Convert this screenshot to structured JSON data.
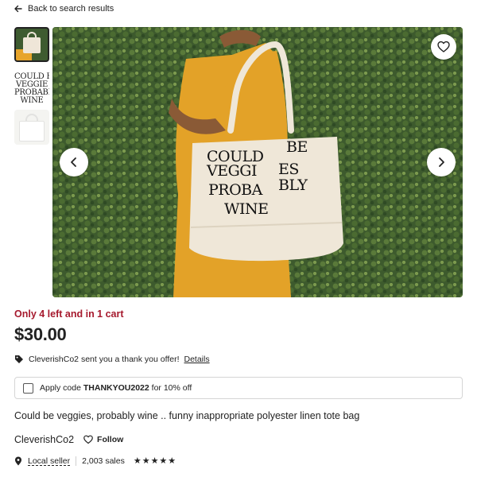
{
  "nav": {
    "back_label": "Back to search results"
  },
  "gallery": {
    "thumbnail_text_lines": [
      "COULD B",
      "VEGGIE",
      "PROBABL",
      "WINE"
    ],
    "bag_print": [
      "COULD",
      "BE",
      "VEGGI",
      "ES",
      "PROBA",
      "BLY",
      "WINE",
      ""
    ]
  },
  "stock_status": "Only 4 left and in 1 cart",
  "price": "$30.00",
  "offer": {
    "text": "CleverishCo2 sent you a thank you offer!",
    "details_label": "Details"
  },
  "coupon": {
    "prefix": "Apply code ",
    "code": "THANKYOU2022",
    "suffix": " for 10% off"
  },
  "listing_title": "Could be veggies, probably wine .. funny inappropriate polyester linen tote bag",
  "shop": {
    "name": "CleverishCo2",
    "follow_label": "Follow",
    "local_label": "Local seller",
    "sales": "2,003 sales",
    "rating_stars": "★★★★★"
  },
  "colors": {
    "stock": "#a61a2e",
    "text": "#222222",
    "shirt": "#e7a42a",
    "hedge": "#3f5a2e"
  }
}
